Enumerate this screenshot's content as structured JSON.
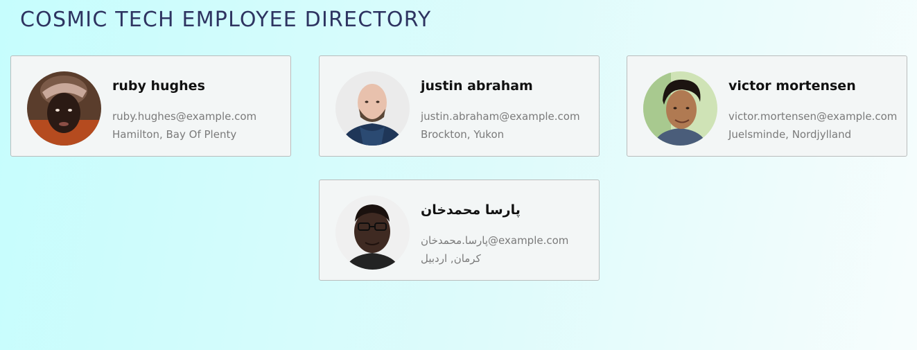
{
  "page": {
    "title": "COSMIC TECH EMPLOYEE DIRECTORY"
  },
  "employees": [
    {
      "name": "ruby hughes",
      "email": "ruby.hughes@example.com",
      "location": "Hamilton, Bay Of Plenty",
      "avatar_icon": "person-avatar-icon"
    },
    {
      "name": "justin abraham",
      "email": "justin.abraham@example.com",
      "location": "Brockton, Yukon",
      "avatar_icon": "person-avatar-icon"
    },
    {
      "name": "victor mortensen",
      "email": "victor.mortensen@example.com",
      "location": "Juelsminde, Nordjylland",
      "avatar_icon": "person-avatar-icon"
    },
    {
      "name": "پارسا محمدخان",
      "email": "پارسا.محمدخان@example.com",
      "location": "کرمان, اردبیل",
      "avatar_icon": "person-avatar-icon"
    }
  ],
  "colors": {
    "title": "#2e3461",
    "card_background": "#f3f6f6",
    "card_border": "#b9bcbc",
    "secondary_text": "#7a7a7a"
  }
}
